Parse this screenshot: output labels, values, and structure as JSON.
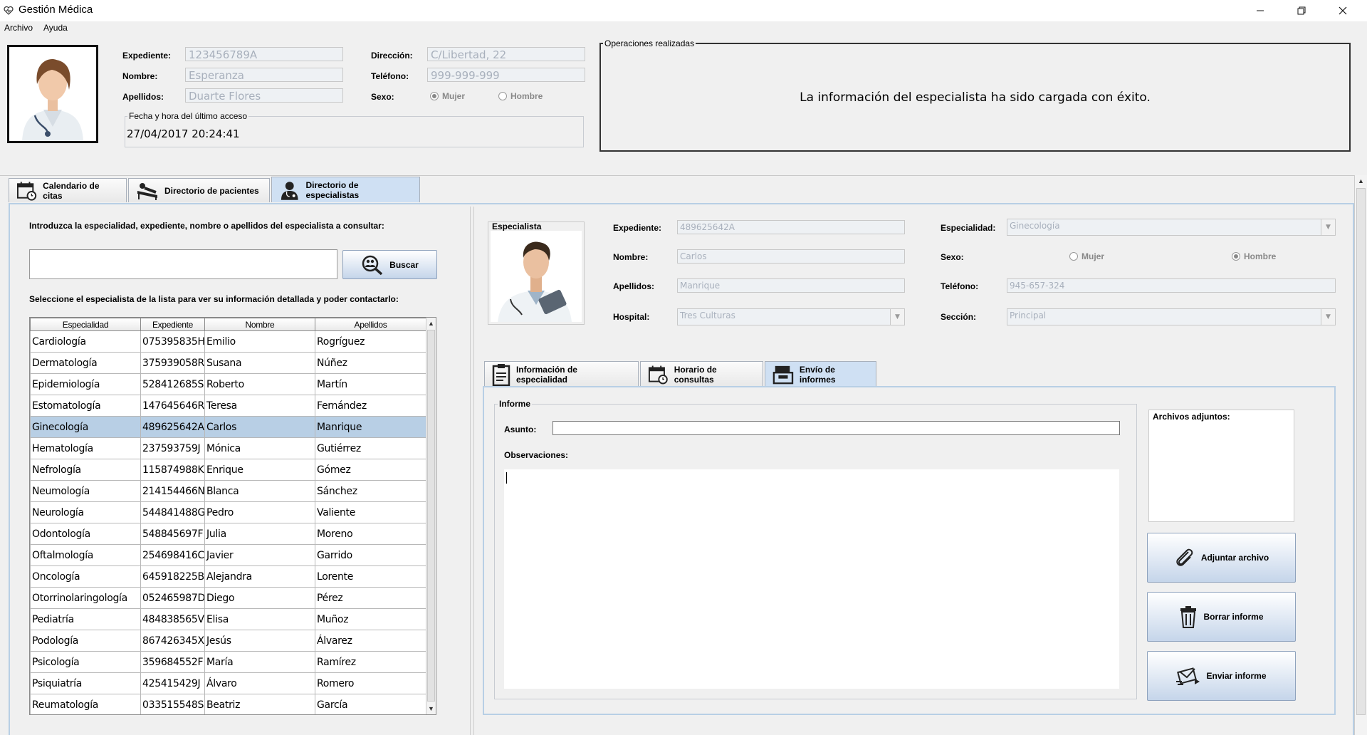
{
  "app": {
    "title": "Gestión Médica"
  },
  "menu": [
    {
      "label": "Archivo"
    },
    {
      "label": "Ayuda"
    }
  ],
  "user": {
    "expediente_label": "Expediente:",
    "expediente": "123456789A",
    "nombre_label": "Nombre:",
    "nombre": "Esperanza",
    "apellidos_label": "Apellidos:",
    "apellidos": "Duarte Flores",
    "direccion_label": "Dirección:",
    "direccion": "C/Libertad, 22",
    "telefono_label": "Teléfono:",
    "telefono": "999-999-999",
    "sexo_label": "Sexo:",
    "mujer": "Mujer",
    "hombre": "Hombre",
    "sexo_selected": "Mujer",
    "last_access_label": "Fecha y hora del último acceso",
    "last_access": "27/04/2017 20:24:41"
  },
  "operations": {
    "label": "Operaciones realizadas",
    "message": "La información del especialista ha sido cargada con éxito."
  },
  "main_tabs": [
    {
      "label": "Calendario de citas",
      "icon": "calendar-clock-icon"
    },
    {
      "label": "Directorio de pacientes",
      "icon": "patient-bed-icon"
    },
    {
      "label": "Directorio de especialistas",
      "icon": "doctor-icon",
      "selected": true
    }
  ],
  "search": {
    "instruction": "Introduzca la especialidad, expediente, nombre o apellidos del especialista a consultar:",
    "value": "",
    "button": "Buscar",
    "list_instruction": "Seleccione el especialista de la lista para ver su información detallada y poder contactarlo:"
  },
  "table": {
    "headers": [
      "Especialidad",
      "Expediente",
      "Nombre",
      "Apellidos"
    ],
    "rows": [
      [
        "Cardiología",
        "075395835H",
        "Emilio",
        "Rogríguez"
      ],
      [
        "Dermatología",
        "375939058R",
        "Susana",
        "Núñez"
      ],
      [
        "Epidemiología",
        "528412685S",
        "Roberto",
        "Martín"
      ],
      [
        "Estomatología",
        "147645646R",
        "Teresa",
        "Fernández"
      ],
      [
        "Ginecología",
        "489625642A",
        "Carlos",
        "Manrique"
      ],
      [
        "Hematología",
        "237593759J",
        "Mónica",
        "Gutiérrez"
      ],
      [
        "Nefrología",
        "115874988K",
        "Enrique",
        "Gómez"
      ],
      [
        "Neumología",
        "214154466N",
        "Blanca",
        "Sánchez"
      ],
      [
        "Neurología",
        "544841488G",
        "Pedro",
        "Valiente"
      ],
      [
        "Odontología",
        "548845697F",
        "Julia",
        "Moreno"
      ],
      [
        "Oftalmología",
        "254698416C",
        "Javier",
        "Garrido"
      ],
      [
        "Oncología",
        "645918225B",
        "Alejandra",
        "Lorente"
      ],
      [
        "Otorrinolaringología",
        "052465987D",
        "Diego",
        "Pérez"
      ],
      [
        "Pediatría",
        "484838565V",
        "Elisa",
        "Muñoz"
      ],
      [
        "Podología",
        "867426345X",
        "Jesús",
        "Álvarez"
      ],
      [
        "Psicología",
        "359684552F",
        "María",
        "Ramírez"
      ],
      [
        "Psiquiatría",
        "425415429J",
        "Álvaro",
        "Romero"
      ],
      [
        "Reumatología",
        "033515548S",
        "Beatriz",
        "García"
      ]
    ],
    "selected_index": 4
  },
  "specialist": {
    "photo_label": "Especialista",
    "expediente_label": "Expediente:",
    "expediente": "489625642A",
    "nombre_label": "Nombre:",
    "nombre": "Carlos",
    "apellidos_label": "Apellidos:",
    "apellidos": "Manrique",
    "hospital_label": "Hospital:",
    "hospital": "Tres Culturas",
    "especialidad_label": "Especialidad:",
    "especialidad": "Ginecología",
    "sexo_label": "Sexo:",
    "mujer": "Mujer",
    "hombre": "Hombre",
    "sexo_selected": "Hombre",
    "telefono_label": "Teléfono:",
    "telefono": "945-657-324",
    "seccion_label": "Sección:",
    "seccion": "Principal"
  },
  "sub_tabs": [
    {
      "label": "Información de especialidad",
      "icon": "clipboard-icon"
    },
    {
      "label": "Horario de consultas",
      "icon": "calendar-clock-icon"
    },
    {
      "label": "Envío de informes",
      "icon": "mailbox-icon",
      "selected": true
    }
  ],
  "report": {
    "group_label": "Informe",
    "asunto_label": "Asunto:",
    "asunto": "",
    "observaciones_label": "Observaciones:",
    "observaciones": "",
    "attachments_label": "Archivos adjuntos:",
    "attach_button": "Adjuntar archivo",
    "delete_button": "Borrar informe",
    "send_button": "Enviar informe"
  }
}
